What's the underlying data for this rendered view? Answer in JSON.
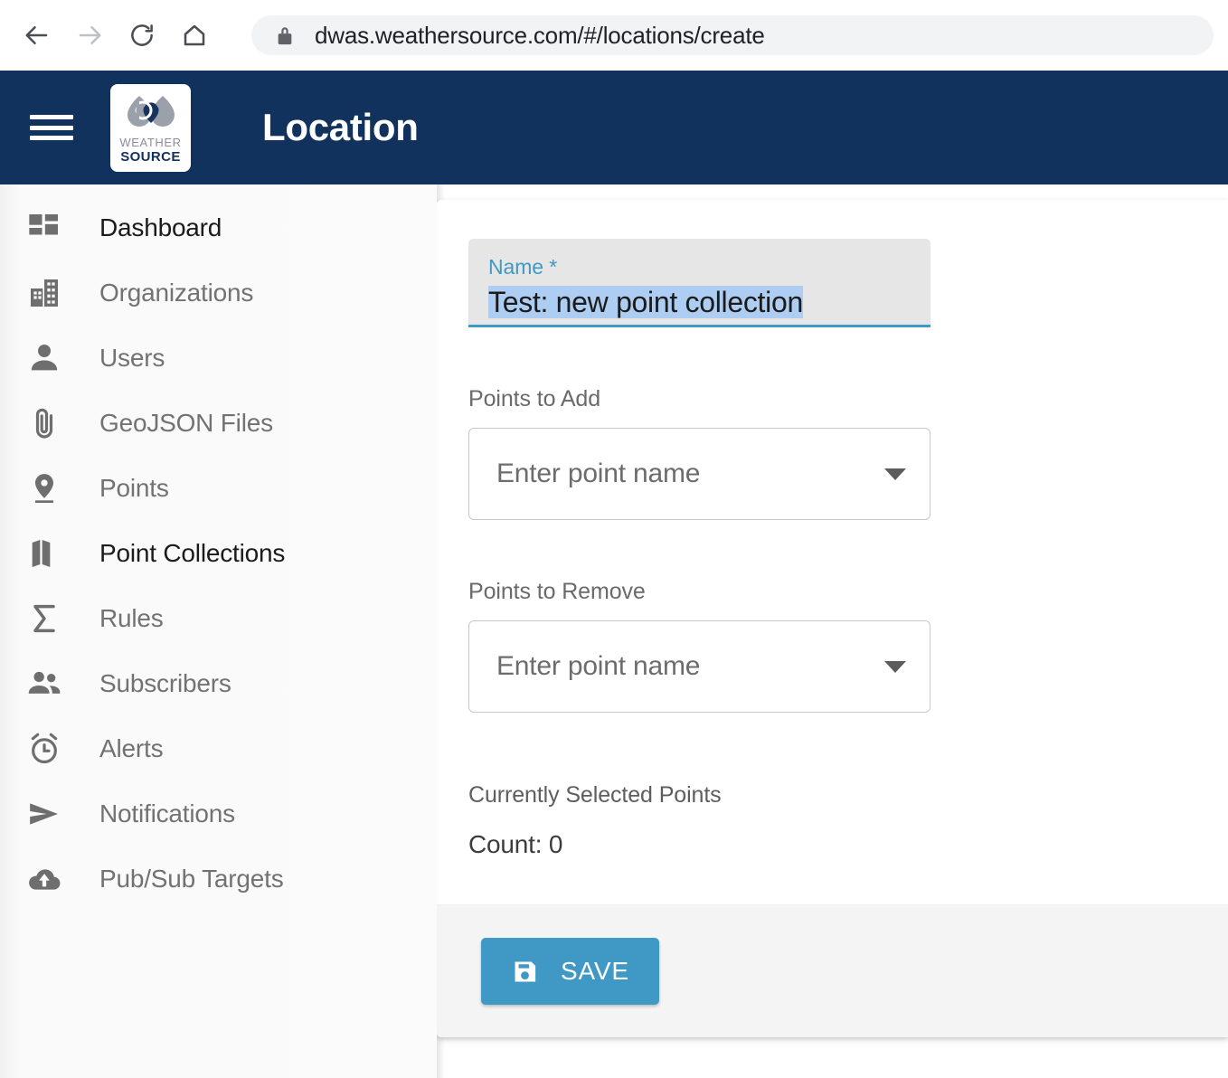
{
  "browser": {
    "back_icon": "arrow-left-icon",
    "forward_icon": "arrow-right-icon",
    "reload_icon": "reload-icon",
    "home_icon": "home-icon",
    "lock_icon": "lock-icon",
    "url": "dwas.weathersource.com/#/locations/create"
  },
  "header": {
    "menu_icon": "hamburger-menu-icon",
    "logo": {
      "icon": "weather-source-droplets-logo",
      "word_top": "WEATHER",
      "word_bottom": "SOURCE"
    },
    "title": "Location",
    "background": "#11325c"
  },
  "sidebar": {
    "items": [
      {
        "label": "Dashboard",
        "icon": "dashboard-grid-icon",
        "active": true
      },
      {
        "label": "Organizations",
        "icon": "building-icon",
        "active": false
      },
      {
        "label": "Users",
        "icon": "person-icon",
        "active": false
      },
      {
        "label": "GeoJSON Files",
        "icon": "paperclip-icon",
        "active": false
      },
      {
        "label": "Points",
        "icon": "map-pin-icon",
        "active": false
      },
      {
        "label": "Point Collections",
        "icon": "map-folded-icon",
        "active": true
      },
      {
        "label": "Rules",
        "icon": "sigma-icon",
        "active": false
      },
      {
        "label": "Subscribers",
        "icon": "people-group-icon",
        "active": false
      },
      {
        "label": "Alerts",
        "icon": "alarm-clock-icon",
        "active": false
      },
      {
        "label": "Notifications",
        "icon": "send-paper-plane-icon",
        "active": false
      },
      {
        "label": "Pub/Sub Targets",
        "icon": "cloud-upload-icon",
        "active": false
      }
    ]
  },
  "form": {
    "name_field": {
      "label": "Name *",
      "value": "Test: new point collection",
      "selected": true,
      "accent_color": "#4098c4",
      "selection_color": "#aecdf2"
    },
    "points_to_add": {
      "caption": "Points to Add",
      "placeholder": "Enter point name",
      "value": "",
      "chevron_icon": "chevron-down-icon"
    },
    "points_to_remove": {
      "caption": "Points to Remove",
      "placeholder": "Enter point name",
      "value": "",
      "chevron_icon": "chevron-down-icon"
    },
    "summary": {
      "title": "Currently Selected Points",
      "count_label": "Count: 0"
    },
    "footer": {
      "save_label": "SAVE",
      "save_icon": "floppy-disk-save-icon",
      "save_color": "#4098c4"
    }
  }
}
